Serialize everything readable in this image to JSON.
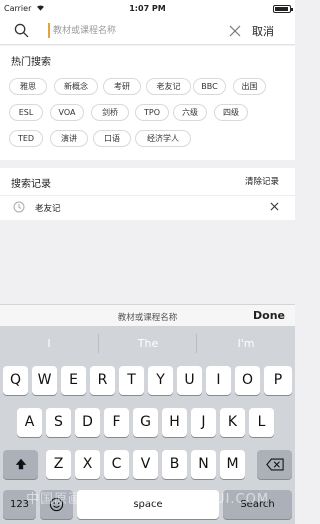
{
  "status_bar": {
    "carrier": "Carrier",
    "time": "1:07 PM"
  },
  "search": {
    "placeholder": "教材或课程名称",
    "value": "",
    "cancel_label": "取消"
  },
  "hot": {
    "title": "热门搜索",
    "tags": [
      "雅思",
      "新概念",
      "考研",
      "老友记",
      "BBC",
      "出国",
      "ESL",
      "VOA",
      "剑桥",
      "TPO",
      "六级",
      "四级",
      "TED",
      "演讲",
      "口语",
      "经济学人"
    ]
  },
  "history": {
    "title": "搜索记录",
    "clear_label": "清除记录",
    "items": [
      "老友记"
    ]
  },
  "accessory": {
    "text": "教材或课程名称",
    "done_label": "Done"
  },
  "keyboard": {
    "predictions": [
      "I",
      "The",
      "I'm"
    ],
    "row1": [
      "Q",
      "W",
      "E",
      "R",
      "T",
      "Y",
      "U",
      "I",
      "O",
      "P"
    ],
    "row2": [
      "A",
      "S",
      "D",
      "F",
      "G",
      "H",
      "J",
      "K",
      "L"
    ],
    "row3": [
      "Z",
      "X",
      "C",
      "V",
      "B",
      "N",
      "M"
    ],
    "numbers_label": "123",
    "space_label": "space",
    "search_label": "Search",
    "icons": {
      "shift": "shift-icon",
      "delete": "delete-icon",
      "emoji": "emoji-icon"
    }
  },
  "watermark": "中国原画 • HUAHUAXUANHUI.COM"
}
